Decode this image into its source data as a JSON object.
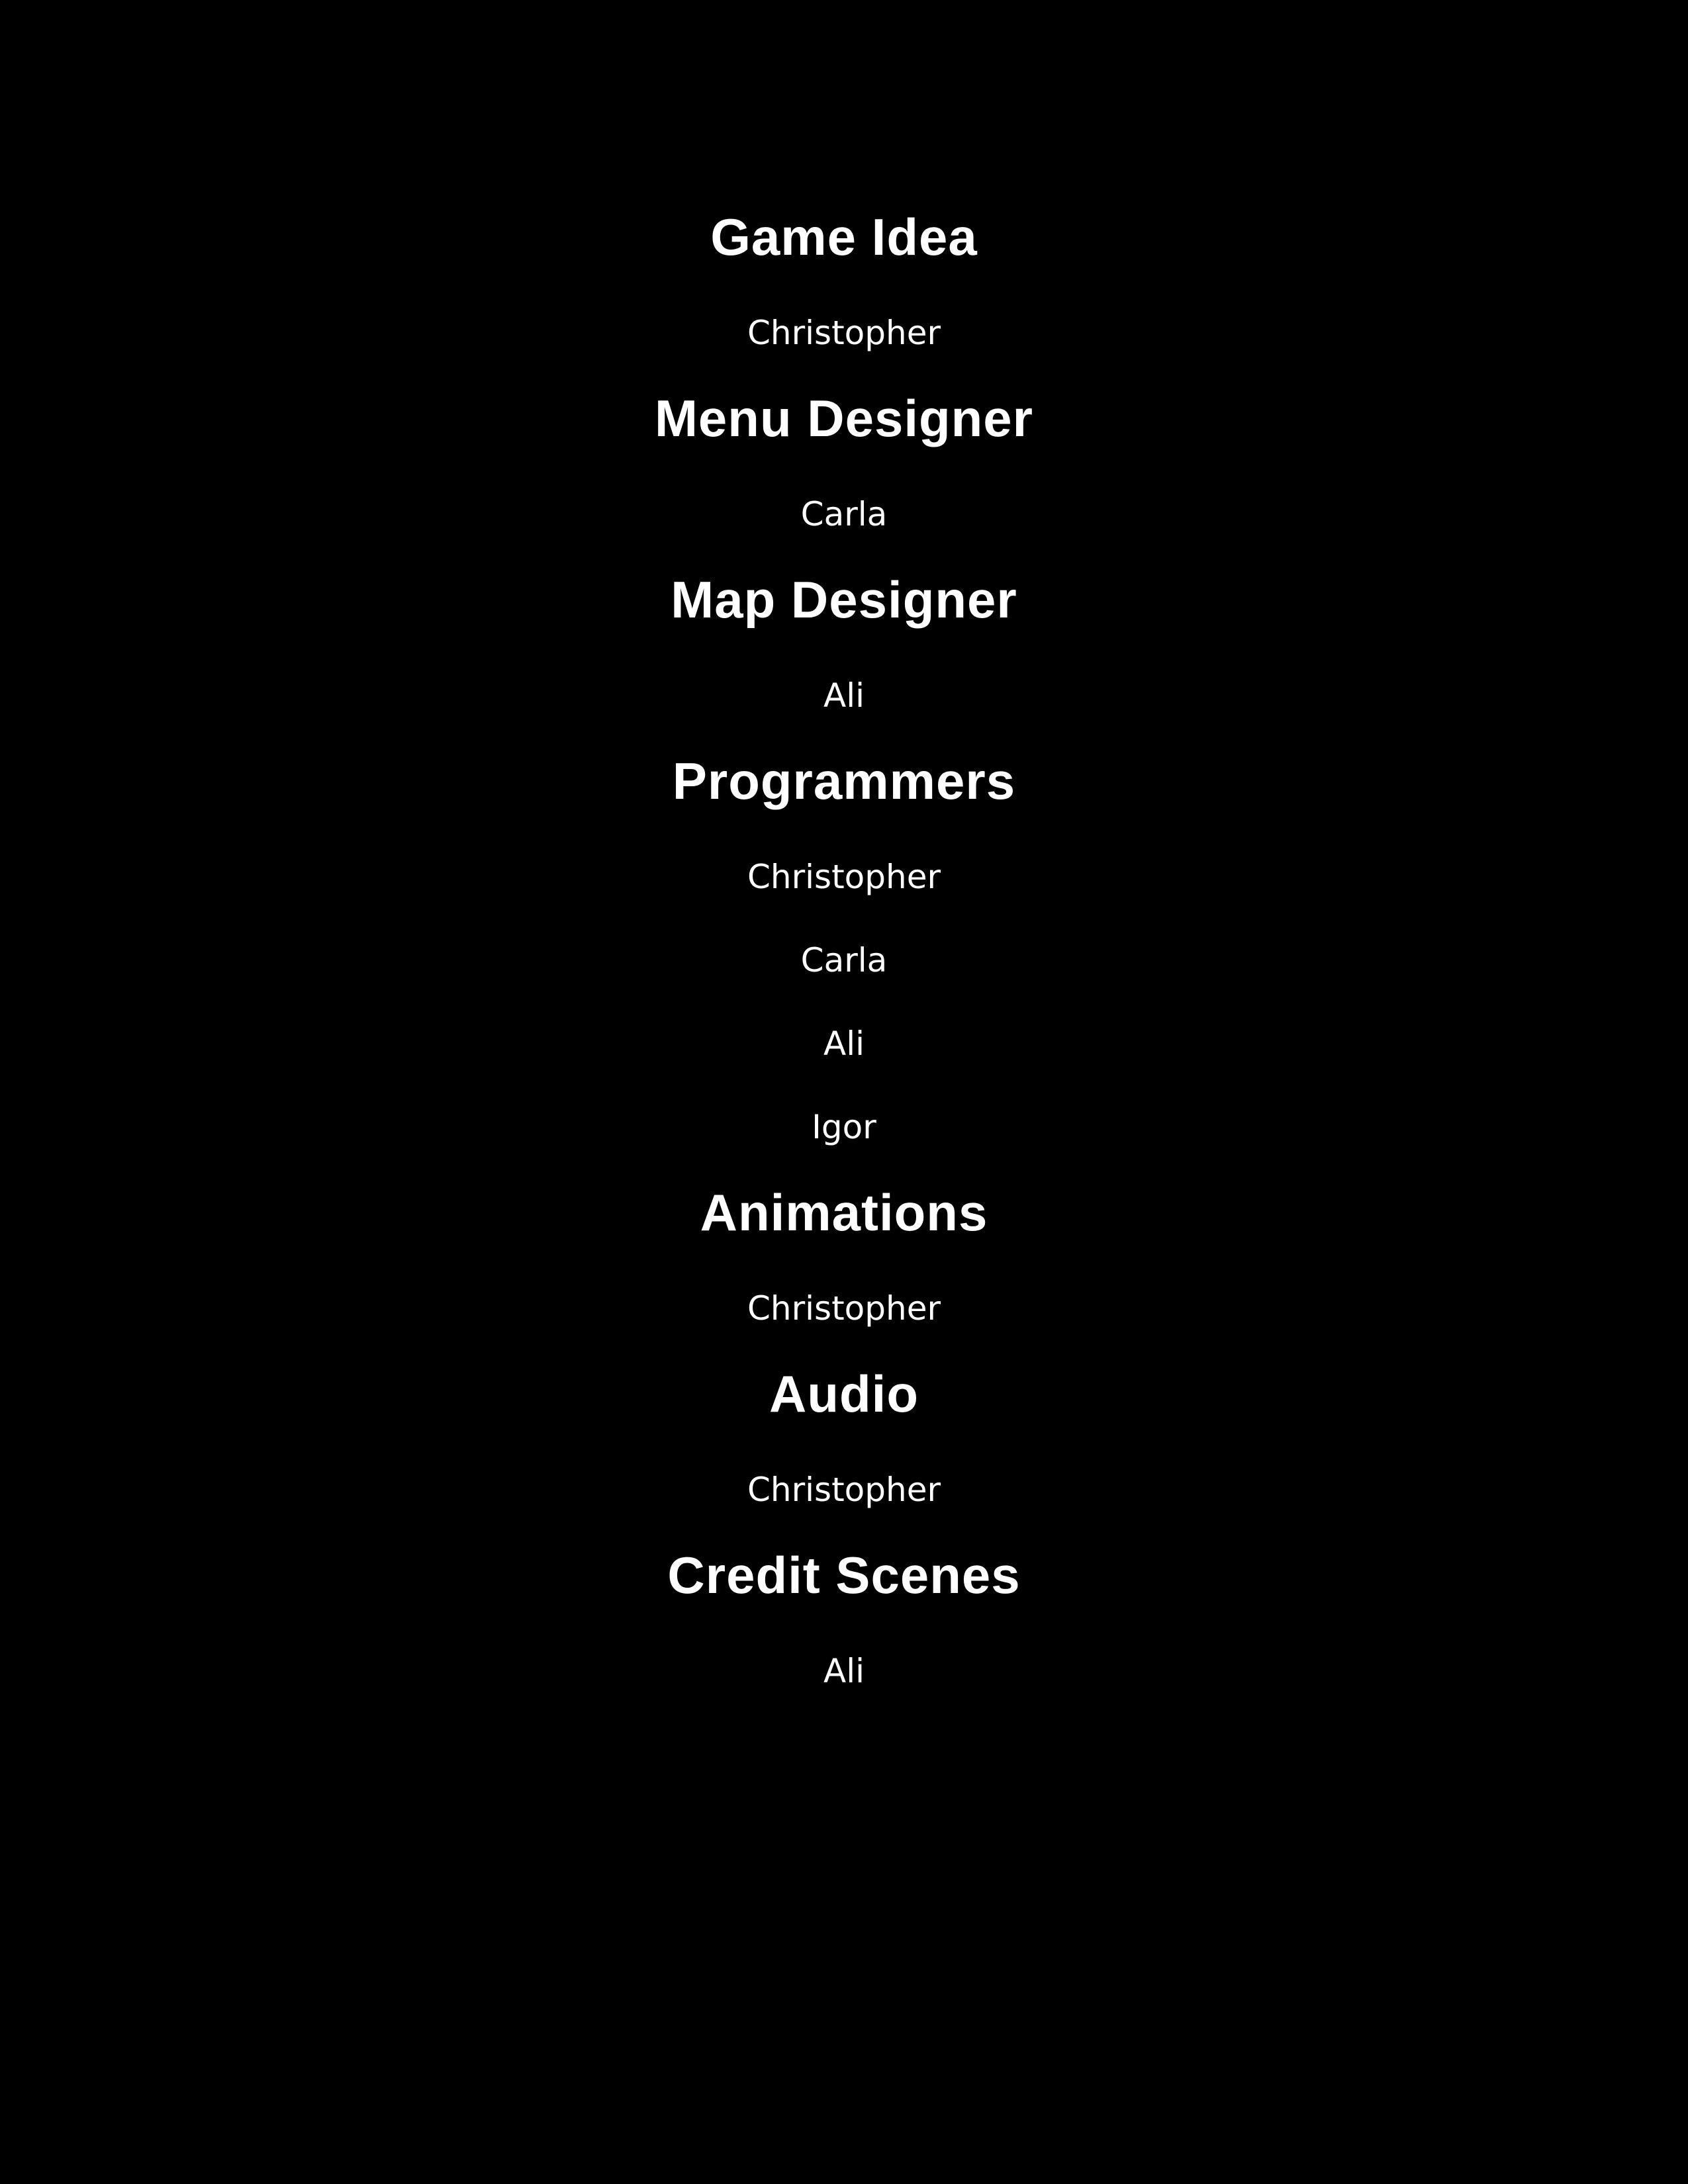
{
  "colors": {
    "background": "#000000",
    "text": "#ffffff"
  },
  "sections": [
    {
      "title": "Game Idea",
      "members": [
        "Christopher"
      ]
    },
    {
      "title": "Menu Designer",
      "members": [
        "Carla"
      ]
    },
    {
      "title": "Map Designer",
      "members": [
        "Ali"
      ]
    },
    {
      "title": "Programmers",
      "members": [
        "Christopher",
        "Carla",
        "Ali",
        "Igor"
      ]
    },
    {
      "title": "Animations",
      "members": [
        "Christopher"
      ]
    },
    {
      "title": "Audio",
      "members": [
        "Christopher"
      ]
    },
    {
      "title": "Credit Scenes",
      "members": [
        "Ali"
      ]
    }
  ]
}
